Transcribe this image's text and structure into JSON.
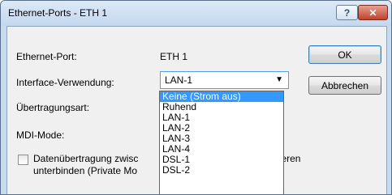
{
  "window": {
    "title": "Ethernet-Ports - ETH 1",
    "help_label": "?",
    "close_label": "✕"
  },
  "form": {
    "ethernet_port_label": "Ethernet-Port:",
    "ethernet_port_value": "ETH 1",
    "interface_label": "Interface-Verwendung:",
    "interface_value": "LAN-1",
    "transfer_label": "Übertragungsart:",
    "mdi_label": "MDI-Mode:",
    "checkbox_text_left_1": "Datenübertragung zwisc",
    "checkbox_text_right_1": "nd den anderen",
    "checkbox_text_left_2": "unterbinden (Private Mo",
    "private_mode_checked": false
  },
  "buttons": {
    "ok": "OK",
    "cancel": "Abbrechen"
  },
  "dropdown": {
    "selected_index": 0,
    "options": [
      "Keine (Strom aus)",
      "Ruhend",
      "LAN-1",
      "LAN-2",
      "LAN-3",
      "LAN-4",
      "DSL-1",
      "DSL-2"
    ]
  },
  "colors": {
    "selection": "#3399ff",
    "title_bar": "#c9dbef",
    "close_button": "#c4412c"
  }
}
